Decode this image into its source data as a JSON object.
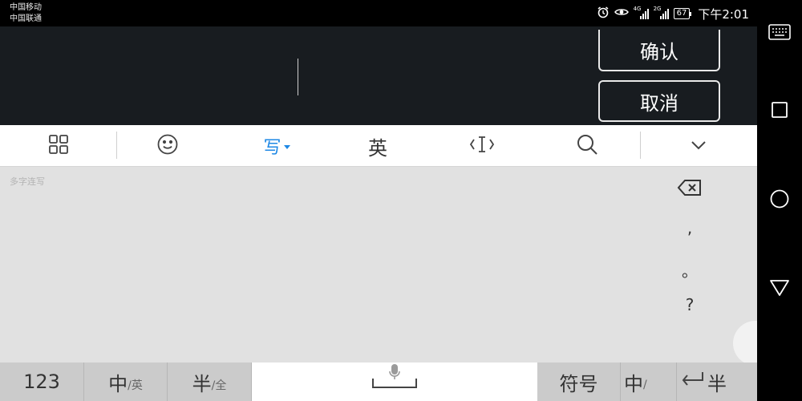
{
  "status_bar": {
    "carrier_1": "中国移动",
    "carrier_2": "中国联通",
    "network_1": "4G",
    "network_2": "2G",
    "battery": "67",
    "time": "下午2:01"
  },
  "dialog": {
    "confirm_label": "确认",
    "cancel_label": "取消"
  },
  "toolbar": {
    "write_label": "写",
    "english_label": "英"
  },
  "handwriting": {
    "hint": "多字连写",
    "side_keys": [
      ",",
      "。",
      "?"
    ]
  },
  "bottom_row": {
    "num_label": "123",
    "cn_en_main": "中",
    "cn_en_sub": "/英",
    "half_full_main": "半",
    "half_full_sub": "/全",
    "symbol_label": "符号",
    "lang_label": "中",
    "lang_sub": "/",
    "half_label": "半"
  },
  "colors": {
    "accent": "#1e88e5",
    "dark_bg": "#181c20",
    "pad_bg": "#e1e1e1"
  }
}
